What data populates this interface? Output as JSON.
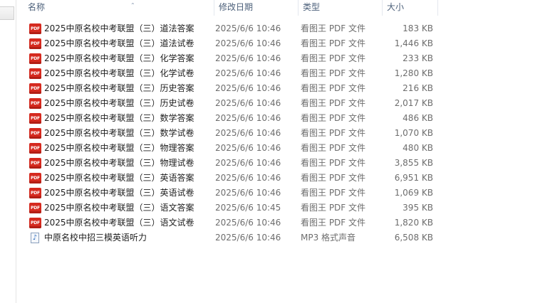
{
  "columns": {
    "name": "名称",
    "date": "修改日期",
    "type": "类型",
    "size": "大小"
  },
  "files": [
    {
      "name": "2025中原名校中考联盟（三）道法答案",
      "date": "2025/6/6 10:46",
      "type": "看图王 PDF 文件",
      "size": "183 KB",
      "icon": "pdf-icon"
    },
    {
      "name": "2025中原名校中考联盟（三）道法试卷",
      "date": "2025/6/6 10:46",
      "type": "看图王 PDF 文件",
      "size": "1,446 KB",
      "icon": "pdf-icon"
    },
    {
      "name": "2025中原名校中考联盟（三）化学答案",
      "date": "2025/6/6 10:46",
      "type": "看图王 PDF 文件",
      "size": "233 KB",
      "icon": "pdf-icon"
    },
    {
      "name": "2025中原名校中考联盟（三）化学试卷",
      "date": "2025/6/6 10:46",
      "type": "看图王 PDF 文件",
      "size": "1,280 KB",
      "icon": "pdf-icon"
    },
    {
      "name": "2025中原名校中考联盟（三）历史答案",
      "date": "2025/6/6 10:46",
      "type": "看图王 PDF 文件",
      "size": "216 KB",
      "icon": "pdf-icon"
    },
    {
      "name": "2025中原名校中考联盟（三）历史试卷",
      "date": "2025/6/6 10:46",
      "type": "看图王 PDF 文件",
      "size": "2,017 KB",
      "icon": "pdf-icon"
    },
    {
      "name": "2025中原名校中考联盟（三）数学答案",
      "date": "2025/6/6 10:46",
      "type": "看图王 PDF 文件",
      "size": "486 KB",
      "icon": "pdf-icon"
    },
    {
      "name": "2025中原名校中考联盟（三）数学试卷",
      "date": "2025/6/6 10:46",
      "type": "看图王 PDF 文件",
      "size": "1,070 KB",
      "icon": "pdf-icon"
    },
    {
      "name": "2025中原名校中考联盟（三）物理答案",
      "date": "2025/6/6 10:46",
      "type": "看图王 PDF 文件",
      "size": "480 KB",
      "icon": "pdf-icon"
    },
    {
      "name": "2025中原名校中考联盟（三）物理试卷",
      "date": "2025/6/6 10:46",
      "type": "看图王 PDF 文件",
      "size": "3,855 KB",
      "icon": "pdf-icon"
    },
    {
      "name": "2025中原名校中考联盟（三）英语答案",
      "date": "2025/6/6 10:46",
      "type": "看图王 PDF 文件",
      "size": "6,951 KB",
      "icon": "pdf-icon"
    },
    {
      "name": "2025中原名校中考联盟（三）英语试卷",
      "date": "2025/6/6 10:46",
      "type": "看图王 PDF 文件",
      "size": "1,069 KB",
      "icon": "pdf-icon"
    },
    {
      "name": "2025中原名校中考联盟（三）语文答案",
      "date": "2025/6/6 10:45",
      "type": "看图王 PDF 文件",
      "size": "395 KB",
      "icon": "pdf-icon"
    },
    {
      "name": "2025中原名校中考联盟（三）语文试卷",
      "date": "2025/6/6 10:46",
      "type": "看图王 PDF 文件",
      "size": "1,820 KB",
      "icon": "pdf-icon"
    },
    {
      "name": "中原名校中招三模英语听力",
      "date": "2025/6/6 10:46",
      "type": "MP3 格式声音",
      "size": "6,508 KB",
      "icon": "audio-file-icon"
    }
  ]
}
